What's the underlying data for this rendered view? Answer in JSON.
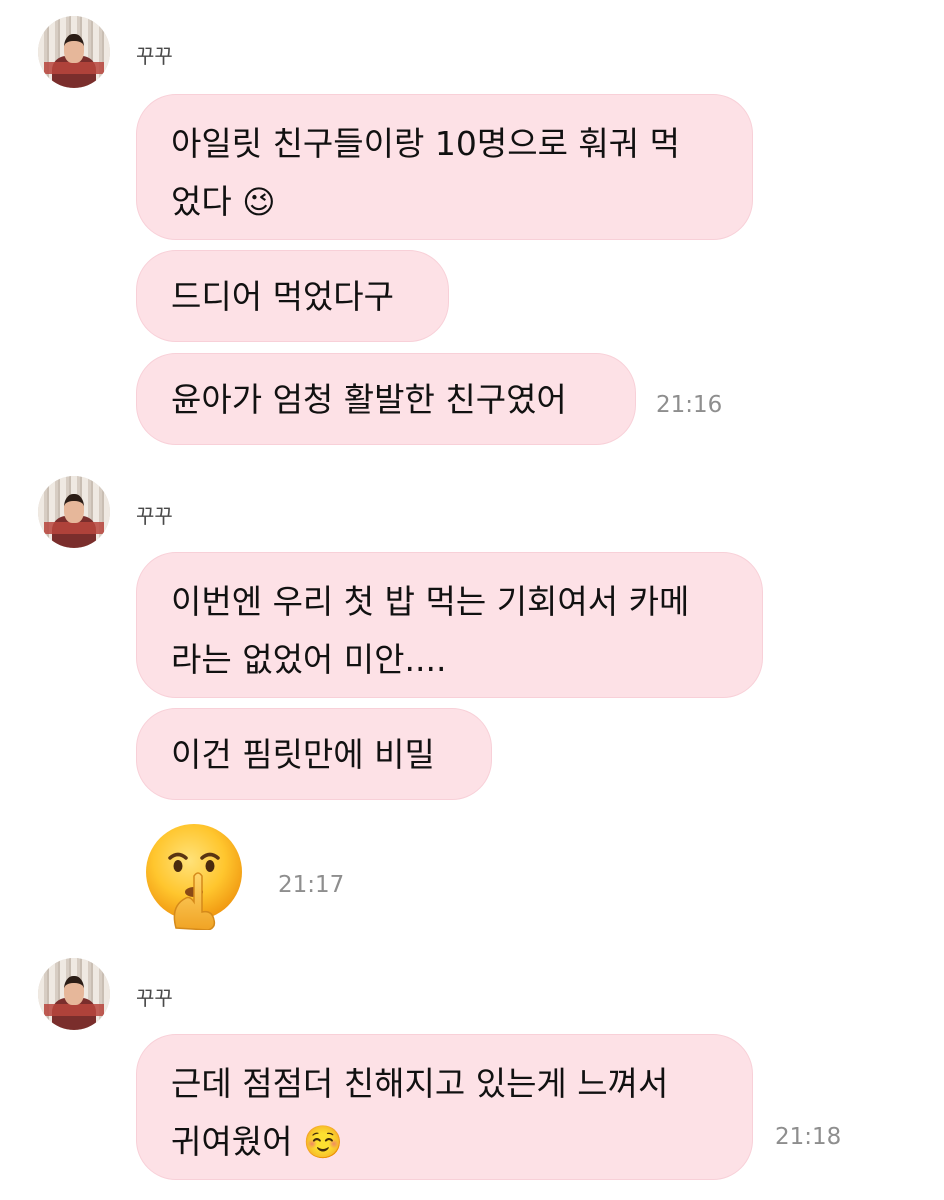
{
  "sender": {
    "name": "꾸꾸"
  },
  "groups": [
    {
      "sender_name": "꾸꾸",
      "messages": [
        {
          "line1": "아일릿 친구들이랑 10명으로 훠궈 먹",
          "line2": "었다",
          "emoji": "😉"
        },
        {
          "text": "드디어 먹었다구"
        },
        {
          "text": "윤아가 엄청 활발한 친구였어"
        }
      ],
      "time": "21:16"
    },
    {
      "sender_name": "꾸꾸",
      "messages": [
        {
          "line1": "이번엔 우리 첫 밥 먹는 기회여서 카메",
          "line2": "라는 없었어 미안...."
        },
        {
          "text": "이건 핌릿만에 비밀"
        },
        {
          "emoji": "🤫"
        }
      ],
      "time": "21:17"
    },
    {
      "sender_name": "꾸꾸",
      "messages": [
        {
          "line1": "근데 점점더 친해지고 있는게 느껴서",
          "line2": "귀여웠어",
          "emoji": "☺️"
        }
      ],
      "time": "21:18"
    }
  ],
  "colors": {
    "bubble": "#fde1e6",
    "bubble_border": "#f8d0d8",
    "timestamp": "#8e8e8e"
  }
}
